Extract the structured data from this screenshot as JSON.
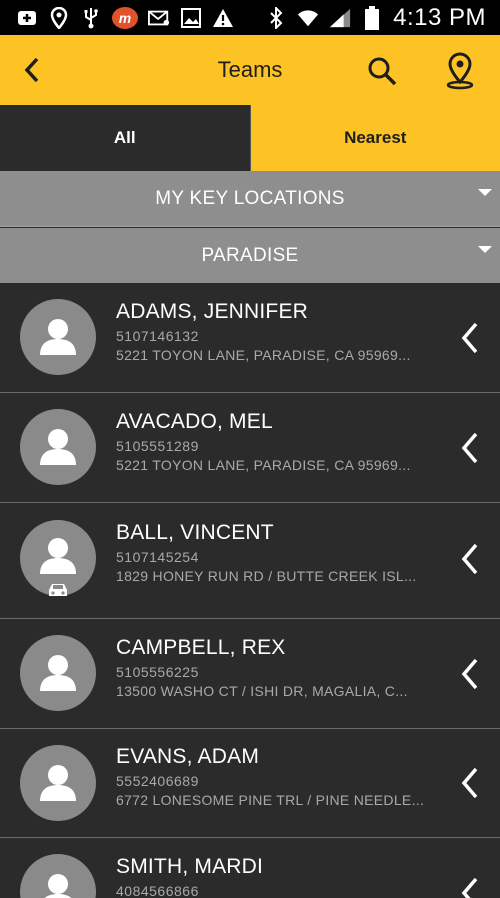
{
  "status_bar": {
    "time": "4:13 PM",
    "left_icons": [
      "add-box-icon",
      "location-icon",
      "usb-icon",
      "m-app-icon",
      "mail-icon",
      "image-icon",
      "warning-icon"
    ],
    "m_badge": "m",
    "right_icons": [
      "bluetooth-icon",
      "wifi-icon",
      "signal-icon",
      "battery-icon"
    ]
  },
  "header": {
    "title": "Teams",
    "color": "#fdc325"
  },
  "tabs": [
    {
      "label": "All",
      "active": false
    },
    {
      "label": "Nearest",
      "active": true
    }
  ],
  "filters": {
    "key_locations": "MY KEY LOCATIONS",
    "location": "PARADISE"
  },
  "contacts": [
    {
      "name": "ADAMS, JENNIFER",
      "phone": "5107146132",
      "address": "5221 TOYON LANE, PARADISE, CA 95969...",
      "car": false
    },
    {
      "name": "AVACADO, MEL",
      "phone": "5105551289",
      "address": "5221 TOYON LANE, PARADISE, CA 95969...",
      "car": false
    },
    {
      "name": "BALL, VINCENT",
      "phone": "5107145254",
      "address": "1829 HONEY RUN RD / BUTTE CREEK ISL...",
      "car": true
    },
    {
      "name": "CAMPBELL, REX",
      "phone": "5105556225",
      "address": "13500 WASHO CT / ISHI DR, MAGALIA, C...",
      "car": false
    },
    {
      "name": "EVANS, ADAM",
      "phone": "5552406689",
      "address": "6772 LONESOME PINE TRL / PINE NEEDLE...",
      "car": false
    },
    {
      "name": "SMITH, MARDI",
      "phone": "4084566866",
      "address": "",
      "car": false
    }
  ]
}
